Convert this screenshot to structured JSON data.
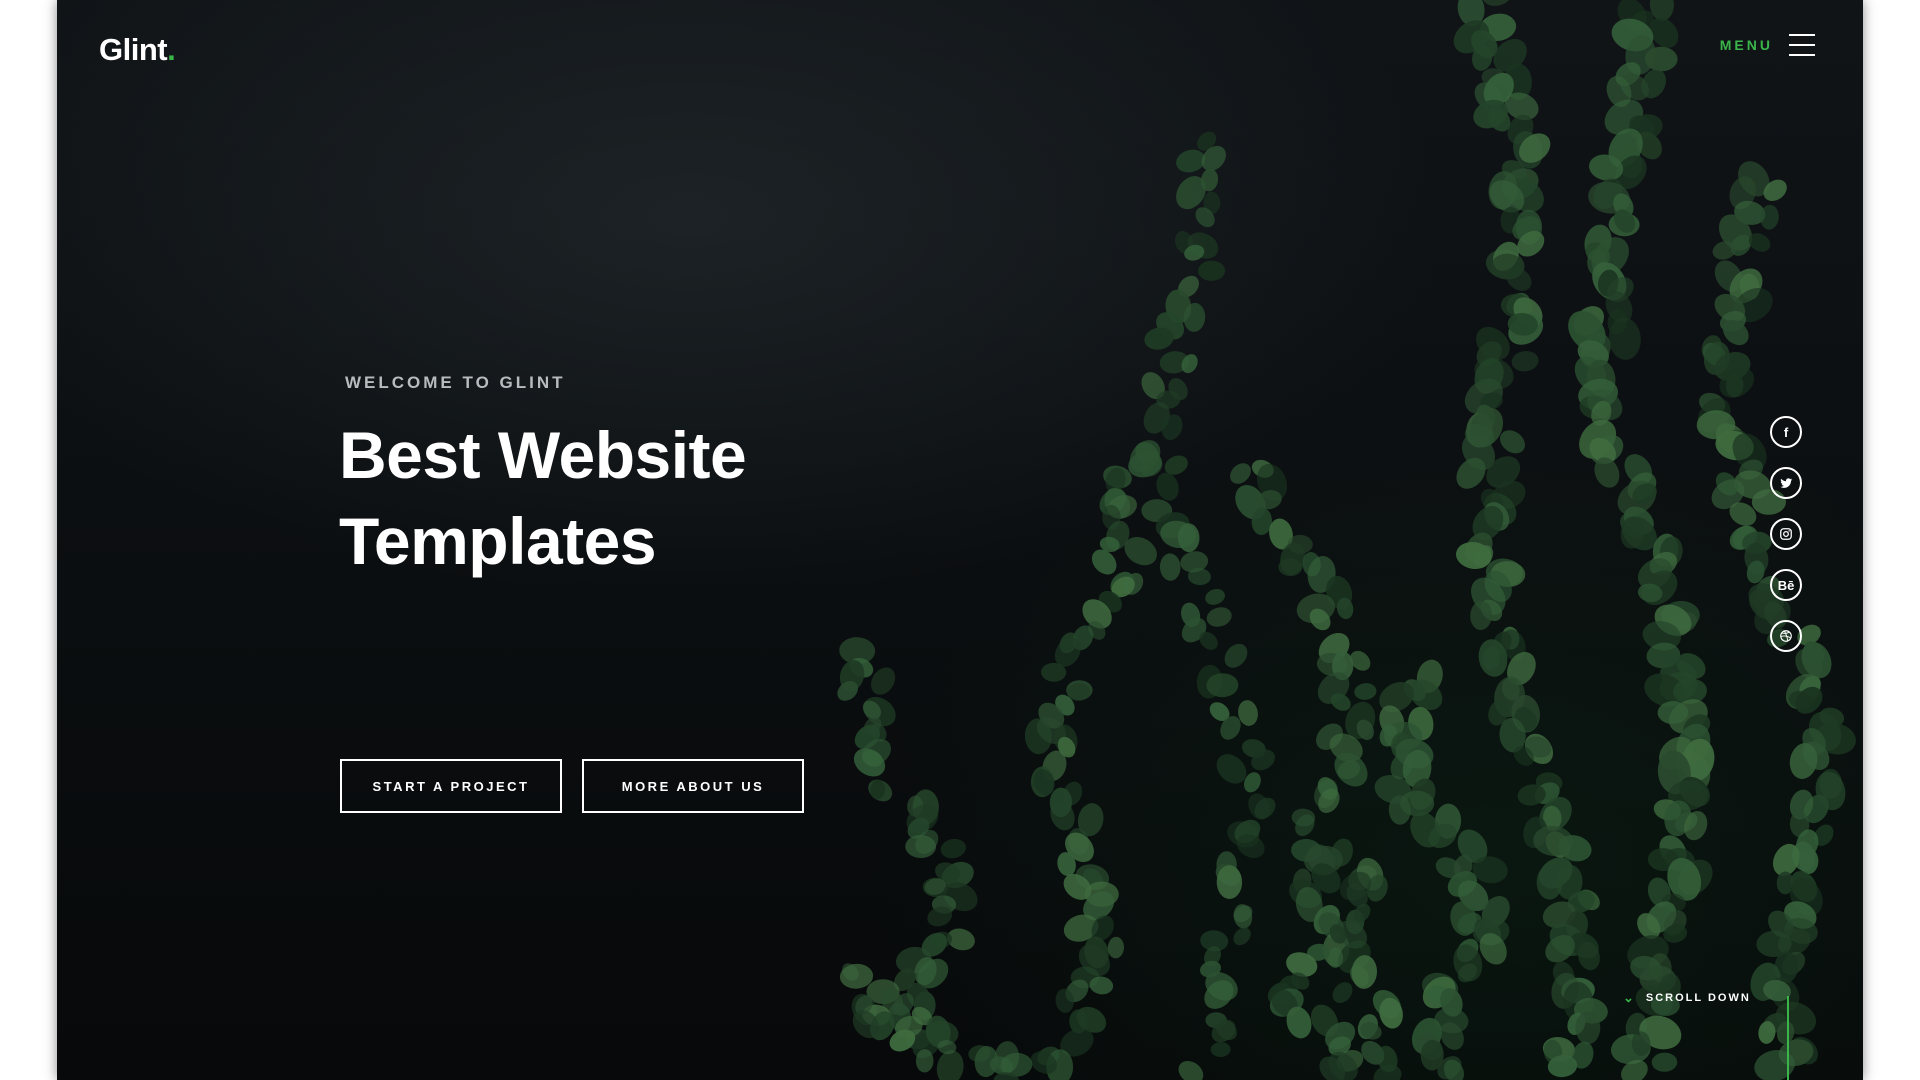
{
  "brand": {
    "name": "Glint",
    "dot": ".",
    "accent": "#39b54a"
  },
  "nav": {
    "menu_label": "MENU",
    "menu_icon": "hamburger-icon"
  },
  "hero": {
    "subtitle": "WELCOME TO GLINT",
    "title": "Best Website\nTemplates",
    "buttons": [
      {
        "label": "START A PROJECT"
      },
      {
        "label": "MORE ABOUT US"
      }
    ]
  },
  "social": [
    {
      "icon": "facebook-icon",
      "glyph": "f"
    },
    {
      "icon": "twitter-icon",
      "glyph": ""
    },
    {
      "icon": "instagram-icon",
      "glyph": ""
    },
    {
      "icon": "behance-icon",
      "glyph": "Bē"
    },
    {
      "icon": "dribbble-icon",
      "glyph": ""
    }
  ],
  "scroll": {
    "label": "SCROLL DOWN",
    "icon": "chevron-down-icon"
  }
}
